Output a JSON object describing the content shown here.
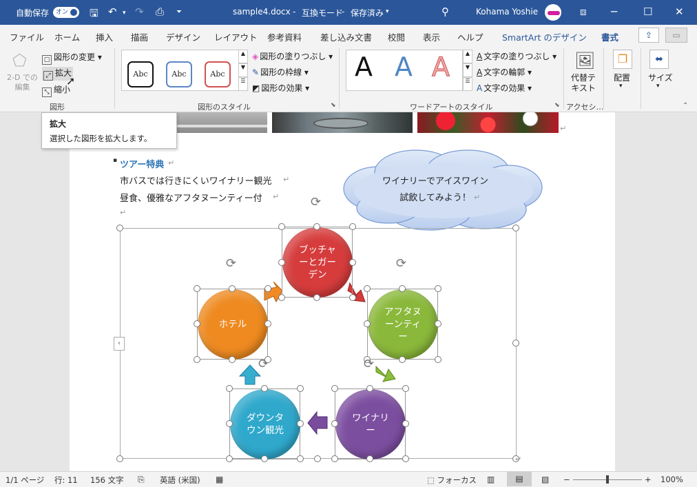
{
  "titlebar": {
    "autosave_label": "自動保存",
    "autosave_state": "オン",
    "filename": "sample4.docx",
    "sep1": "-",
    "mode": "互換モード",
    "sep2": "-",
    "save_state": "保存済み",
    "user": "Kohama Yoshie"
  },
  "tabs": [
    "ファイル",
    "ホーム",
    "挿入",
    "描画",
    "デザイン",
    "レイアウト",
    "参考資料",
    "差し込み文書",
    "校閲",
    "表示",
    "ヘルプ",
    "SmartArt のデザイン",
    "書式"
  ],
  "ribbon": {
    "shapes_group": {
      "edit_2d": "2-D での\n編集",
      "change_shape": "図形の変更",
      "enlarge": "拡大",
      "shrink": "縮小",
      "label": "図形"
    },
    "styles_group": {
      "style_samples": [
        "Abc",
        "Abc",
        "Abc"
      ],
      "fill": "図形の塗りつぶし",
      "outline": "図形の枠線",
      "effects": "図形の効果",
      "label": "図形のスタイル"
    },
    "wordart_group": {
      "samples": [
        "A",
        "A",
        "A"
      ],
      "text_fill": "文字の塗りつぶし",
      "text_outline": "文字の輪郭",
      "text_effects": "文字の効果",
      "label": "ワードアートのスタイル"
    },
    "accessibility": {
      "alt_text": "代替テ\nキスト",
      "label": "アクセシ…"
    },
    "arrange": {
      "label": "配置"
    },
    "size": {
      "label": "サイズ"
    }
  },
  "tooltip": {
    "title": "拡大",
    "desc": "選択した図形を拡大します。"
  },
  "document": {
    "bullet_heading": "ツアー特典",
    "line1": "市バスでは行きにくいワイナリー観光",
    "line2": "昼食、優雅なアフタヌーンティー付",
    "return_mark": "↵",
    "callout": "ワイナリーでアイスワイン\n試飲してみよう！",
    "nodes": [
      {
        "label": "ブッチャ\nーとガー\nデン",
        "color": "#d63c3c"
      },
      {
        "label": "アフタヌ\nーンティ\nー",
        "color": "#8ab83a"
      },
      {
        "label": "ワイナリ\nー",
        "color": "#7c4ea0"
      },
      {
        "label": "ダウンタ\nウン観光",
        "color": "#2fa8cc"
      },
      {
        "label": "ホテル",
        "color": "#ee8a20"
      }
    ]
  },
  "status": {
    "page": "1/1 ページ",
    "line": "行: 11",
    "chars": "156 文字",
    "lang": "英語 (米国)",
    "focus": "フォーカス",
    "zoom": "100%"
  },
  "colors": {
    "accent": "#2b579a"
  }
}
